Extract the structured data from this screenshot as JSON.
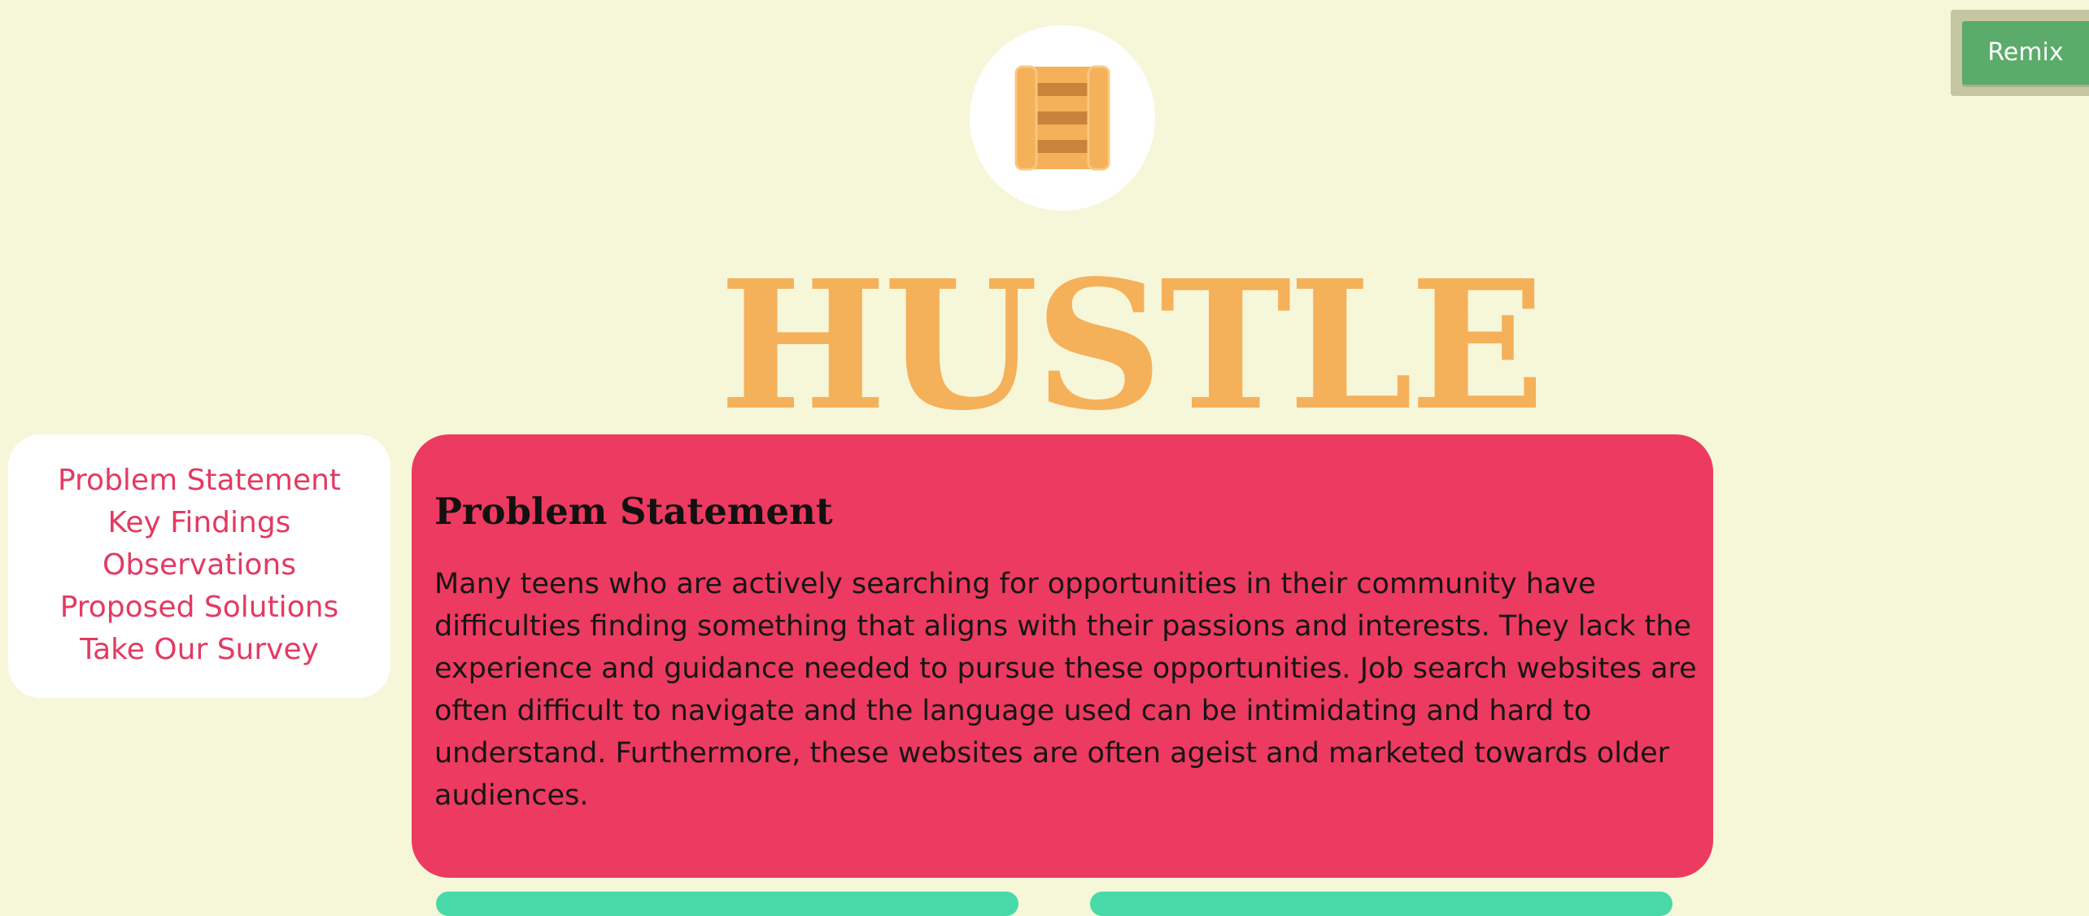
{
  "header": {
    "logo_icon": "ladder-icon",
    "title": "HUSTLE"
  },
  "remix": {
    "label": "Remix"
  },
  "nav": {
    "items": [
      {
        "label": "Problem Statement"
      },
      {
        "label": "Key Findings"
      },
      {
        "label": "Observations"
      },
      {
        "label": "Proposed Solutions"
      },
      {
        "label": "Take Our Survey"
      }
    ]
  },
  "problem": {
    "heading": "Problem Statement",
    "body": "Many teens who are actively searching for opportunities in their community have difficulties finding something that aligns with their passions and interests. They lack the experience and guidance needed to pursue these opportunities. Job search websites are often difficult to navigate and the language used can be intimidating and hard to understand. Furthermore, these websites are often ageist and marketed towards older audiences."
  },
  "colors": {
    "background": "#f6f6d9",
    "title": "#f5b05a",
    "accent_pink": "#ed3a60",
    "nav_text": "#e33a62",
    "remix_green": "#5bab6a",
    "teaser_green": "#49d9a8"
  }
}
